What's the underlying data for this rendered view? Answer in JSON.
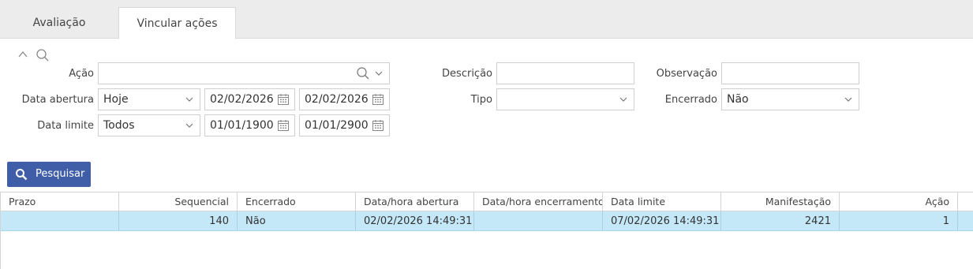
{
  "tabs": [
    {
      "label": "Avaliação",
      "active": false
    },
    {
      "label": "Vincular ações",
      "active": true
    }
  ],
  "filters": {
    "acao": {
      "label": "Ação",
      "value": ""
    },
    "descricao": {
      "label": "Descrição",
      "value": ""
    },
    "observacao": {
      "label": "Observação",
      "value": ""
    },
    "data_abertura": {
      "label": "Data abertura",
      "period": "Hoje",
      "from": "02/02/2026",
      "to": "02/02/2026"
    },
    "tipo": {
      "label": "Tipo",
      "value": ""
    },
    "encerrado": {
      "label": "Encerrado",
      "value": "Não"
    },
    "data_limite": {
      "label": "Data limite",
      "period": "Todos",
      "from": "01/01/1900",
      "to": "01/01/2900"
    }
  },
  "search_button": {
    "label": "Pesquisar"
  },
  "grid": {
    "columns": [
      "Prazo",
      "Sequencial",
      "Encerrado",
      "Data/hora abertura",
      "Data/hora encerramento",
      "Data limite",
      "Manifestação",
      "Ação"
    ],
    "rows": [
      {
        "prazo": "",
        "sequencial": "140",
        "encerrado": "Não",
        "abertura": "02/02/2026 14:49:31",
        "encerramento": "",
        "data_limite": "07/02/2026 14:49:31",
        "manifestacao": "2421",
        "acao": "1"
      }
    ]
  },
  "colors": {
    "primary_button": "#3f5ea7",
    "selected_row": "#c4e8f8"
  },
  "icons": [
    "chevron-up-icon",
    "search-icon",
    "chevron-down-icon",
    "calendar-icon"
  ]
}
